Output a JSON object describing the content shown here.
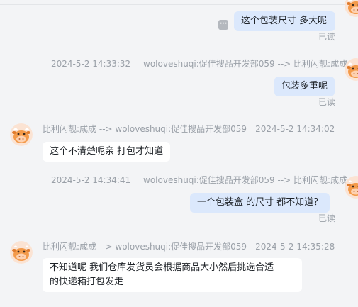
{
  "colors": {
    "background": "#f3f4f6",
    "outgoing_bubble": "#dbe8fc",
    "incoming_bubble": "#ffffff",
    "meta_text": "#9aa0a8"
  },
  "messages": [
    {
      "direction": "outgoing",
      "text": "这个包装尺寸  多大呢",
      "status": "已读"
    },
    {
      "direction": "outgoing",
      "timestamp": "2024-5-2 14:33:32",
      "route": "woloveshuqi:促佳搜品开发部059 --> 比利闪靓:成成",
      "text": "包装多重呢",
      "status": "已读"
    },
    {
      "direction": "incoming",
      "route": "比利闪靓:成成 --> woloveshuqi:促佳搜品开发部059",
      "timestamp": "2024-5-2 14:34:02",
      "text": "这个不清楚呢亲  打包才知道"
    },
    {
      "direction": "outgoing",
      "timestamp": "2024-5-2 14:34:41",
      "route": "woloveshuqi:促佳搜品开发部059 --> 比利闪靓:成成",
      "text": "一个包装盒  的尺寸  都不知道？",
      "status": "已读"
    },
    {
      "direction": "incoming",
      "route": "比利闪靓:成成 --> woloveshuqi:促佳搜品开发部059",
      "timestamp": "2024-5-2 14:35:28",
      "text_lines": [
        "不知道呢 我们仓库发货员会根据商品大小然后挑选合适",
        "的快递箱打包发走"
      ]
    }
  ]
}
